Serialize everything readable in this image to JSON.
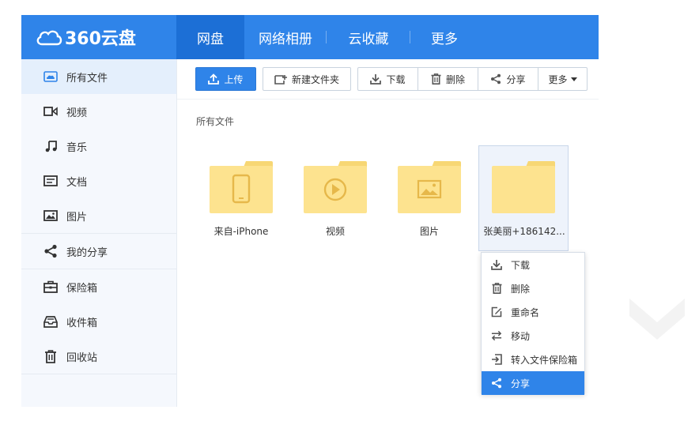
{
  "logo": {
    "text": "360云盘"
  },
  "nav": [
    {
      "label": "网盘"
    },
    {
      "label": "网络相册"
    },
    {
      "label": "云收藏"
    },
    {
      "label": "更多"
    }
  ],
  "sidebar": {
    "items": [
      {
        "label": "所有文件",
        "icon": "cloud-folder-icon"
      },
      {
        "label": "视频",
        "icon": "video-icon"
      },
      {
        "label": "音乐",
        "icon": "music-icon"
      },
      {
        "label": "文档",
        "icon": "document-icon"
      },
      {
        "label": "图片",
        "icon": "image-icon"
      },
      {
        "label": "我的分享",
        "icon": "share-icon"
      },
      {
        "label": "保险箱",
        "icon": "safe-icon"
      },
      {
        "label": "收件箱",
        "icon": "inbox-icon"
      },
      {
        "label": "回收站",
        "icon": "trash-icon"
      }
    ]
  },
  "toolbar": {
    "upload": "上传",
    "new_folder": "新建文件夹",
    "download": "下载",
    "delete": "删除",
    "share": "分享",
    "more": "更多"
  },
  "breadcrumb": "所有文件",
  "files": [
    {
      "name": "来自-iPhone",
      "icon": "phone-icon"
    },
    {
      "name": "视频",
      "icon": "play-icon"
    },
    {
      "name": "图片",
      "icon": "picture-icon"
    },
    {
      "name": "张美丽+186142...",
      "icon": ""
    }
  ],
  "context_menu": [
    {
      "label": "下载",
      "icon": "download-icon"
    },
    {
      "label": "删除",
      "icon": "trash-icon"
    },
    {
      "label": "重命名",
      "icon": "edit-icon"
    },
    {
      "label": "移动",
      "icon": "move-icon"
    },
    {
      "label": "转入文件保险箱",
      "icon": "safe-transfer-icon"
    },
    {
      "label": "分享",
      "icon": "share-icon"
    }
  ],
  "colors": {
    "accent": "#2f84e9",
    "accent_dark": "#1c6fd6",
    "folder": "#fde38f",
    "folder_tab": "#f7d774",
    "folder_glyph": "#e6b84a"
  }
}
